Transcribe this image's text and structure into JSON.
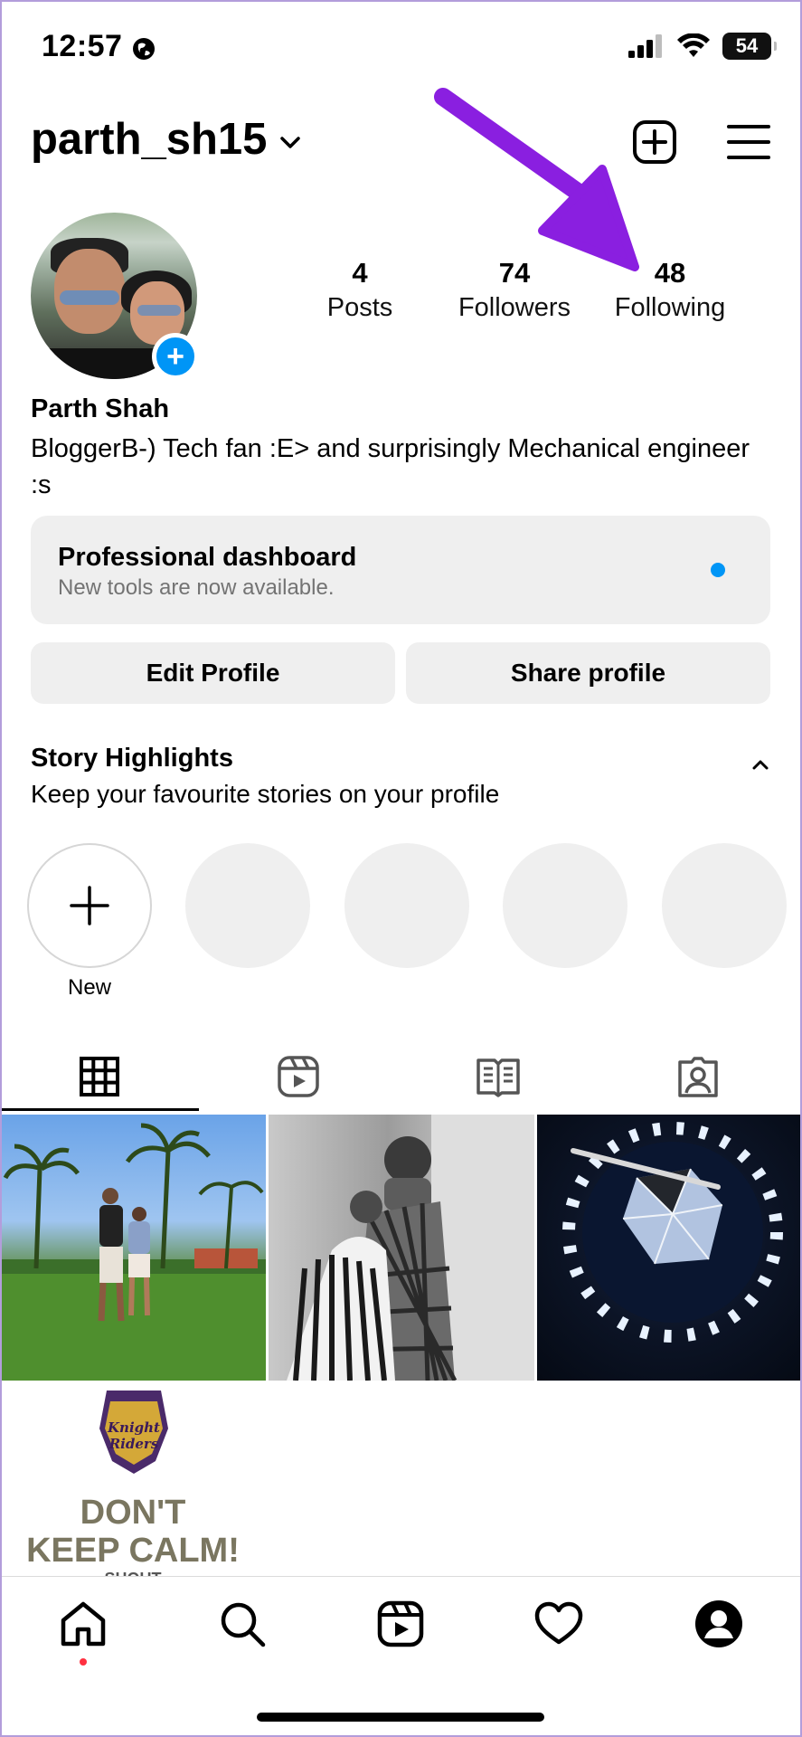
{
  "status_bar": {
    "time": "12:57",
    "battery": "54"
  },
  "header": {
    "username": "parth_sh15"
  },
  "profile": {
    "stats": [
      {
        "value": "4",
        "label": "Posts"
      },
      {
        "value": "74",
        "label": "Followers"
      },
      {
        "value": "48",
        "label": "Following"
      }
    ],
    "name": "Parth Shah",
    "bio": "BloggerB-) Tech fan :E> and surprisingly Mechanical engineer :s"
  },
  "dashboard": {
    "title": "Professional dashboard",
    "subtitle": "New tools are now available."
  },
  "buttons": {
    "edit": "Edit Profile",
    "share": "Share profile"
  },
  "highlights": {
    "title": "Story Highlights",
    "subtitle": "Keep your favourite stories on your profile",
    "new_label": "New"
  },
  "posts": [
    {
      "name": "post-resort-couple"
    },
    {
      "name": "post-bw-couple"
    },
    {
      "name": "post-diamond"
    },
    {
      "name": "post-kkr",
      "text_line1": "DON'T",
      "text_line2": "KEEP CALM!",
      "text_line3": "SHOUT",
      "logo_text": "Knight Riders"
    }
  ],
  "icons": [
    "globe-icon",
    "signal-icon",
    "wifi-icon",
    "chevron-down-icon",
    "new-post-icon",
    "menu-icon",
    "plus-icon",
    "chevron-up-icon",
    "grid-icon",
    "reels-icon",
    "guide-icon",
    "tagged-icon",
    "home-icon",
    "search-icon",
    "reels-nav-icon",
    "heart-icon",
    "profile-icon"
  ],
  "colors": {
    "accent": "#0095f6",
    "arrow": "#8a1fe0",
    "notification": "#ff3040"
  }
}
